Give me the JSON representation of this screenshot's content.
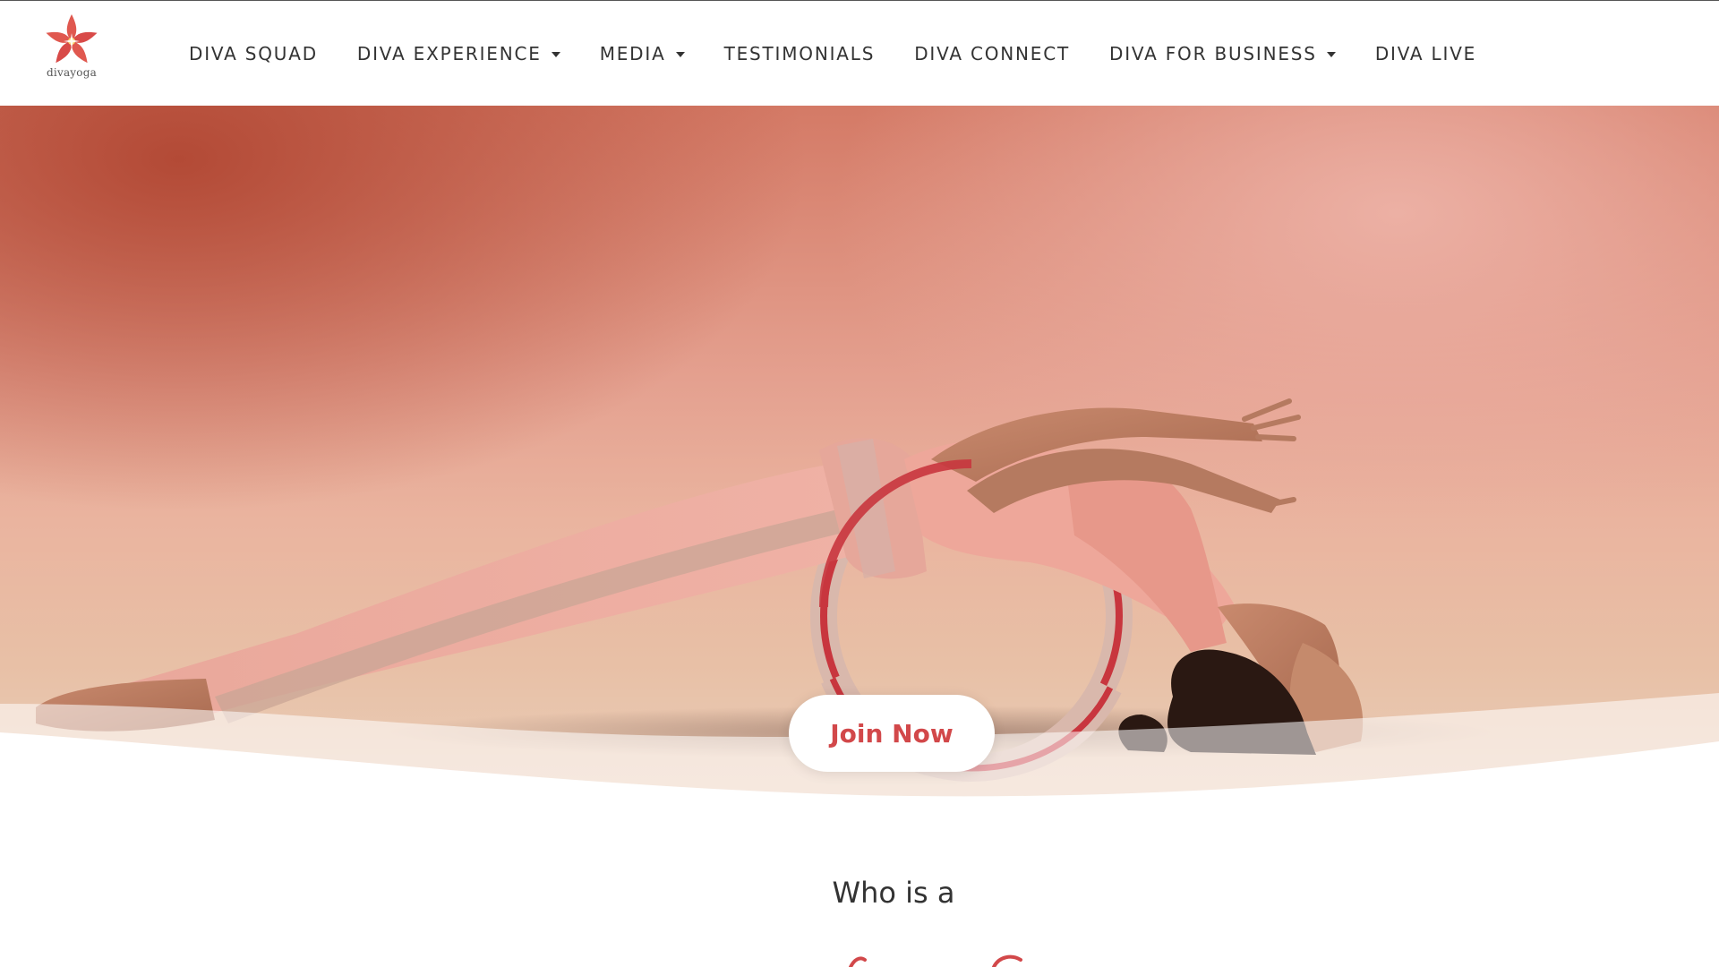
{
  "brand": {
    "logo_text": "divayoga",
    "logo_icon": "flower-star-icon",
    "accent_color": "#d2484a"
  },
  "nav": {
    "items": [
      {
        "label": "DIVA SQUAD",
        "has_dropdown": false
      },
      {
        "label": "DIVA EXPERIENCE",
        "has_dropdown": true
      },
      {
        "label": "MEDIA",
        "has_dropdown": true
      },
      {
        "label": "TESTIMONIALS",
        "has_dropdown": false
      },
      {
        "label": "DIVA CONNECT",
        "has_dropdown": false
      },
      {
        "label": "DIVA FOR BUSINESS",
        "has_dropdown": true
      },
      {
        "label": "DIVA LIVE",
        "has_dropdown": false
      }
    ]
  },
  "hero": {
    "image": "yoga-wheel-backbend-photo",
    "cta_label": "Join Now"
  },
  "intro": {
    "heading": "Who is a"
  }
}
